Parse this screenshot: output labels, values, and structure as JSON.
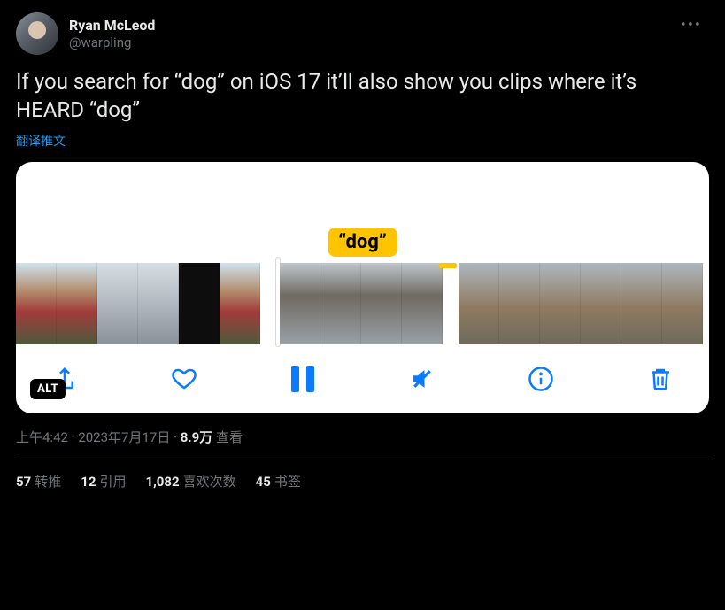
{
  "author": {
    "display_name": "Ryan McLeod",
    "handle": "@warpling"
  },
  "tweet_text": "If you search for “dog” on iOS 17 it’ll also show you clips where it’s HEARD “dog”",
  "translate_label": "翻译推文",
  "media": {
    "tooltip_text": "“dog”",
    "alt_badge": "ALT",
    "toolbar_icons": [
      "share-icon",
      "heart-icon",
      "pause-icon",
      "mute-icon",
      "info-icon",
      "trash-icon"
    ]
  },
  "meta": {
    "time": "上午4:42",
    "separator": " · ",
    "date": "2023年7月17日",
    "views_count": "8.9万",
    "views_label": " 查看"
  },
  "stats": {
    "retweets": {
      "count": "57",
      "label": "转推"
    },
    "quotes": {
      "count": "12",
      "label": "引用"
    },
    "likes": {
      "count": "1,082",
      "label": "喜欢次数"
    },
    "bookmarks": {
      "count": "45",
      "label": "书签"
    }
  },
  "more_label": "•••"
}
